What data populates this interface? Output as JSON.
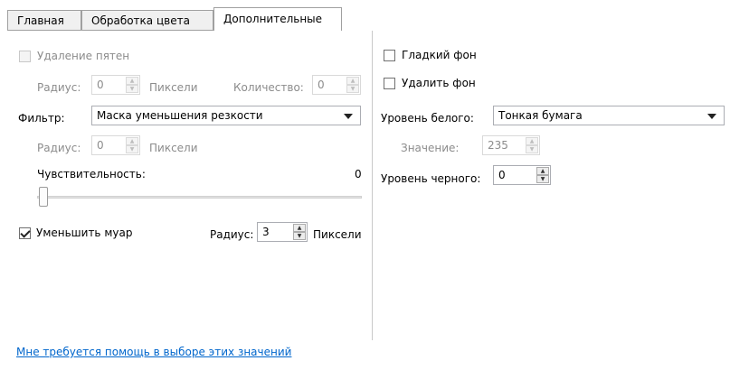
{
  "tabs": [
    {
      "label": "Главная"
    },
    {
      "label": "Обработка цвета"
    },
    {
      "label": "Дополнительные",
      "active": true
    }
  ],
  "left": {
    "despeckle": {
      "label": "Удаление пятен",
      "checked": false,
      "enabled": false
    },
    "radius1": {
      "label": "Радиус:",
      "value": "0",
      "unit": "Пиксели"
    },
    "quantity": {
      "label": "Количество:",
      "value": "0"
    },
    "filter": {
      "label": "Фильтр:",
      "value": "Маска уменьшения резкости"
    },
    "radius2": {
      "label": "Радиус:",
      "value": "0",
      "unit": "Пиксели"
    },
    "sensitivity": {
      "label": "Чувствительность:",
      "value": "0",
      "level": 0
    },
    "moire": {
      "label": "Уменьшить муар",
      "checked": true
    },
    "moire_radius": {
      "label": "Радиус:",
      "value": "3",
      "unit": "Пиксели"
    }
  },
  "right": {
    "smooth_bg": {
      "label": "Гладкий фон",
      "checked": false
    },
    "remove_bg": {
      "label": "Удалить фон",
      "checked": false
    },
    "white_level": {
      "label": "Уровень белого:",
      "value": "Тонкая бумага"
    },
    "white_value": {
      "label": "Значение:",
      "value": "235"
    },
    "black_level": {
      "label": "Уровень черного:",
      "value": "0"
    }
  },
  "help_link": "Мне требуется помощь в выборе этих значений"
}
